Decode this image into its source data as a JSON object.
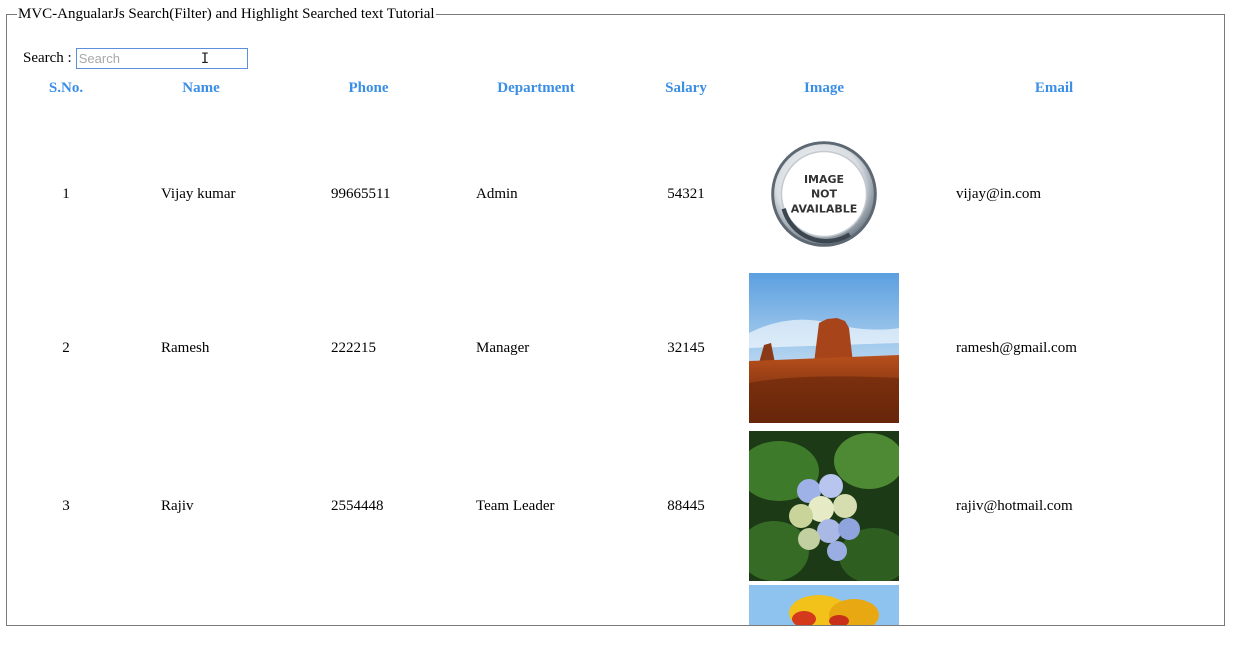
{
  "fieldset": {
    "legend": "MVC-AngualarJs Search(Filter) and Highlight Searched text Tutorial"
  },
  "search": {
    "label": "Search :",
    "placeholder": "Search",
    "value": ""
  },
  "table": {
    "headers": [
      "S.No.",
      "Name",
      "Phone",
      "Department",
      "Salary",
      "Image",
      "Email"
    ],
    "rows": [
      {
        "sno": "1",
        "name": "Vijay kumar",
        "phone": "99665511",
        "department": "Admin",
        "salary": "54321",
        "image": "image-not-available",
        "email": "vijay@in.com"
      },
      {
        "sno": "2",
        "name": "Ramesh",
        "phone": "222215",
        "department": "Manager",
        "salary": "32145",
        "image": "desert-landscape",
        "email": "ramesh@gmail.com"
      },
      {
        "sno": "3",
        "name": "Rajiv",
        "phone": "2554448",
        "department": "Team Leader",
        "salary": "88445",
        "image": "hydrangea-flower",
        "email": "rajiv@hotmail.com"
      },
      {
        "sno": "",
        "name": "",
        "phone": "",
        "department": "",
        "salary": "",
        "image": "tulips",
        "email": ""
      }
    ]
  },
  "images": {
    "placeholder_text_1": "IMAGE",
    "placeholder_text_2": "NOT",
    "placeholder_text_3": "AVAILABLE"
  },
  "colors": {
    "header": "#3a8ee6",
    "border": "#7a7a7a",
    "input_border": "#5b8fd8"
  }
}
